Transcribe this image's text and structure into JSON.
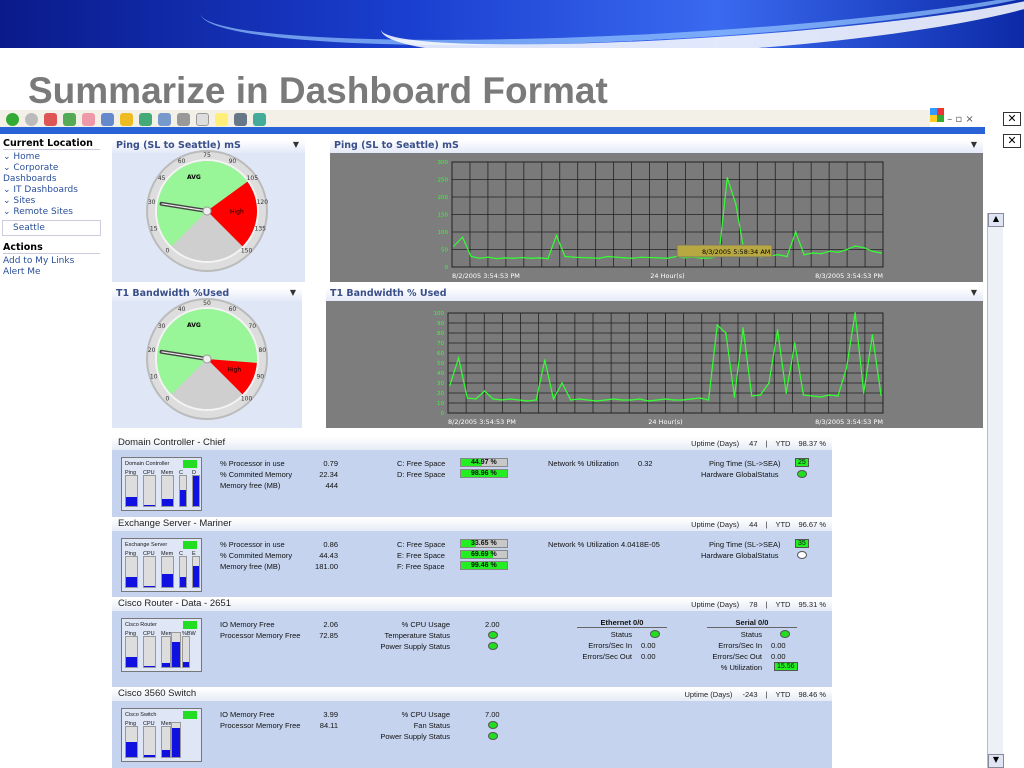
{
  "slide_title": "Summarize in Dashboard Format",
  "sidebar": {
    "current_location_title": "Current Location",
    "items": [
      "Home",
      "Corporate Dashboards",
      "IT Dashboards",
      "Sites",
      "Remote Sites"
    ],
    "selected": "Seattle",
    "actions_title": "Actions",
    "actions": [
      "Add to My Links",
      "Alert Me"
    ]
  },
  "gauges": [
    {
      "title": "Ping (SL to Seattle) mS",
      "ticks": [
        "0",
        "15",
        "30",
        "45",
        "60",
        "75",
        "90",
        "105",
        "120",
        "135",
        "150"
      ],
      "avg_label": "AVG",
      "high_label": "High",
      "needle_value": 30,
      "high_from": 105,
      "max": 150
    },
    {
      "title": "T1 Bandwidth %Used",
      "ticks": [
        "0",
        "10",
        "20",
        "30",
        "40",
        "50",
        "60",
        "70",
        "80",
        "90",
        "100"
      ],
      "avg_label": "AVG",
      "high_label": "High",
      "needle_value": 20,
      "high_from": 85,
      "max": 100
    }
  ],
  "chart_data": [
    {
      "type": "line",
      "title": "Ping (SL to Seattle) mS",
      "ylim": [
        0,
        300
      ],
      "yticks": [
        "0",
        "50",
        "100",
        "150",
        "200",
        "250",
        "300"
      ],
      "x_start": "8/2/2005 3:54:53 PM",
      "x_mid": "24 Hour(s)",
      "x_end": "8/3/2005 3:54:53 PM",
      "tooltip": "8/3/2005 5:58:34 AM",
      "values": [
        60,
        85,
        30,
        25,
        28,
        24,
        26,
        25,
        27,
        25,
        26,
        24,
        90,
        30,
        28,
        27,
        26,
        25,
        30,
        28,
        26,
        25,
        28,
        27,
        26,
        25,
        30,
        26,
        28,
        25,
        26,
        30,
        255,
        180,
        40,
        30,
        28,
        32,
        35,
        30,
        100,
        35,
        40,
        38,
        45,
        42,
        50,
        60,
        55,
        45,
        40
      ]
    },
    {
      "type": "line",
      "title": "T1 Bandwidth % Used",
      "ylim": [
        0,
        100
      ],
      "yticks": [
        "0",
        "10",
        "20",
        "30",
        "40",
        "50",
        "60",
        "70",
        "80",
        "90",
        "100"
      ],
      "x_start": "8/2/2005 3:54:53 PM",
      "x_mid": "24 Hour(s)",
      "x_end": "8/3/2005 3:54:53 PM",
      "values": [
        28,
        55,
        15,
        14,
        22,
        14,
        13,
        14,
        13,
        12,
        13,
        53,
        14,
        30,
        13,
        14,
        13,
        12,
        13,
        14,
        13,
        13,
        14,
        12,
        13,
        14,
        13,
        13,
        14,
        15,
        13,
        88,
        80,
        16,
        85,
        17,
        18,
        30,
        83,
        20,
        70,
        18,
        17,
        16,
        18,
        17,
        45,
        100,
        20,
        78,
        18
      ]
    }
  ],
  "devices": [
    {
      "name": "Domain Controller - Chief",
      "mini": "Domain Controller",
      "bars": [
        {
          "l": "Ping",
          "v": 30
        },
        {
          "l": "CPU",
          "v": 0
        },
        {
          "l": "Mem",
          "v": 22
        },
        {
          "l": "C",
          "v": 55
        },
        {
          "l": "D",
          "v": 99
        }
      ],
      "uptime_label": "Uptime (Days)",
      "uptime": "47",
      "ytd_label": "YTD",
      "ytd": "98.37 %",
      "metrics": [
        [
          "% Processor in use",
          "0.79"
        ],
        [
          "% Commited Memory",
          "22.34"
        ],
        [
          "Memory free (MB)",
          "444"
        ]
      ],
      "disks": [
        [
          "C: Free Space",
          "44.97 %",
          44.97
        ],
        [
          "D: Free Space",
          "98.96 %",
          98.96
        ]
      ],
      "net": [
        "Network % Utilization",
        "0.32"
      ],
      "ping": [
        "Ping Time (SL->SEA)",
        "25"
      ],
      "hw": [
        "Hardware GlobalStatus",
        "ok"
      ]
    },
    {
      "name": "Exchange Server - Mariner",
      "mini": "Exchange Server",
      "bars": [
        {
          "l": "Ping",
          "v": 35
        },
        {
          "l": "CPU",
          "v": 1
        },
        {
          "l": "Mem",
          "v": 44
        },
        {
          "l": "C",
          "v": 34
        },
        {
          "l": "E",
          "v": 70
        }
      ],
      "uptime_label": "Uptime (Days)",
      "uptime": "44",
      "ytd_label": "YTD",
      "ytd": "96.67 %",
      "metrics": [
        [
          "% Processor in use",
          "0.86"
        ],
        [
          "% Commited Memory",
          "44.43"
        ],
        [
          "Memory free (MB)",
          "181.00"
        ]
      ],
      "disks": [
        [
          "C: Free Space",
          "33.65 %",
          33.65
        ],
        [
          "E: Free Space",
          "69.69 %",
          69.69
        ],
        [
          "F: Free Space",
          "99.46 %",
          99.46
        ]
      ],
      "net": [
        "Network % Utilization",
        "4.0418E-05"
      ],
      "ping": [
        "Ping Time (SL->SEA)",
        "35"
      ],
      "hw": [
        "Hardware GlobalStatus",
        "unknown"
      ]
    },
    {
      "name": "Cisco Router - Data - 2651",
      "mini": "Cisco Router",
      "bars": [
        {
          "l": "Ping",
          "v": 35
        },
        {
          "l": "CPU",
          "v": 2
        },
        {
          "l": "Mem",
          "v": 15,
          "v2": 73
        },
        {
          "l": "%BW",
          "v": 16
        }
      ],
      "uptime_label": "Uptime (Days)",
      "uptime": "78",
      "ytd_label": "YTD",
      "ytd": "95.31 %",
      "metrics": [
        [
          "IO Memory Free",
          "2.06"
        ],
        [
          "Processor Memory Free",
          "72.85"
        ]
      ],
      "status": [
        [
          "% CPU Usage",
          "2.00"
        ],
        [
          "Temperature Status",
          "ok"
        ],
        [
          "Power Supply Status",
          "ok"
        ]
      ],
      "eth": {
        "title": "Ethernet 0/0",
        "rows": [
          [
            "Status",
            "ok"
          ],
          [
            "Errors/Sec In",
            "0.00"
          ],
          [
            "Errors/Sec Out",
            "0.00"
          ]
        ]
      },
      "ser": {
        "title": "Serial 0/0",
        "rows": [
          [
            "Status",
            "ok"
          ],
          [
            "Errors/Sec In",
            "0.00"
          ],
          [
            "Errors/Sec Out",
            "0.00"
          ],
          [
            "% Utilization",
            "15.56"
          ]
        ]
      }
    },
    {
      "name": "Cisco 3560 Switch",
      "mini": "Cisco Switch",
      "bars": [
        {
          "l": "Ping",
          "v": 50
        },
        {
          "l": "CPU",
          "v": 7
        },
        {
          "l": "Mem",
          "v": 25,
          "v2": 84
        }
      ],
      "uptime_label": "Uptime (Days)",
      "uptime": "-243",
      "ytd_label": "YTD",
      "ytd": "98.46 %",
      "metrics": [
        [
          "IO Memory Free",
          "3.99"
        ],
        [
          "Processor Memory Free",
          "84.11"
        ]
      ],
      "status": [
        [
          "% CPU Usage",
          "7.00"
        ],
        [
          "Fan Status",
          "ok"
        ],
        [
          "Power Supply Status",
          "ok"
        ]
      ]
    }
  ],
  "colors": {
    "ok": "#22dd22",
    "high": "#ff0000",
    "avg": "#98f598",
    "line": "#33ff33",
    "chart_bg": "#7d7d7d"
  }
}
